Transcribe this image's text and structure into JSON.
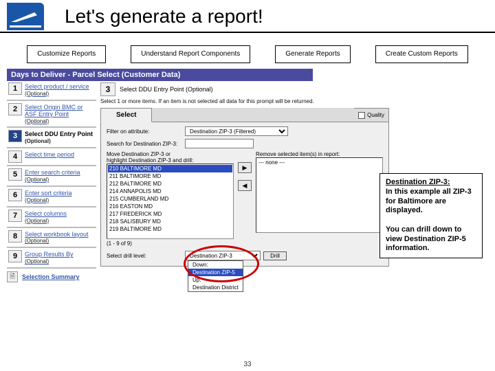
{
  "header": {
    "title": "Let's generate a report!"
  },
  "nav": [
    {
      "label": "Customize Reports"
    },
    {
      "label": "Understand Report Components"
    },
    {
      "label": "Generate Reports"
    },
    {
      "label": "Create Custom Reports"
    }
  ],
  "breadcrumb": "Days to Deliver - Parcel Select (Customer Data)",
  "steps": [
    {
      "n": "1",
      "label": "Select product / service",
      "sub": "(Optional)"
    },
    {
      "n": "2",
      "label": "Select Origin BMC or ASF Entry Point",
      "sub": "(Optional)"
    },
    {
      "n": "3",
      "label": "Select DDU Entry Point",
      "sub": "(Optional)",
      "current": true
    },
    {
      "n": "4",
      "label": "Select time period",
      "sub": ""
    },
    {
      "n": "5",
      "label": "Enter search criteria",
      "sub": "(Optional)"
    },
    {
      "n": "6",
      "label": "Enter sort criteria",
      "sub": "(Optional)"
    },
    {
      "n": "7",
      "label": "Select columns",
      "sub": "(Optional)"
    },
    {
      "n": "8",
      "label": "Select workbook layout",
      "sub": "(Optional)"
    },
    {
      "n": "9",
      "label": "Group Results By",
      "sub": "(Optional)"
    }
  ],
  "summary": {
    "label": "Selection Summary"
  },
  "main": {
    "stepnum": "3",
    "heading": "Select DDU Entry Point (Optional)",
    "instr": "Select 1 or more items. If an item is not selected all data for this prompt will be returned."
  },
  "tabs": {
    "select": "Select",
    "quality": "Quality"
  },
  "filter": {
    "lbl_on": "Filter on attribute:",
    "attr": "Destination ZIP-3 (Filtered)",
    "lbl_search": "Search for Destination ZIP-3:",
    "search": ""
  },
  "left": {
    "caption1": "Move Destination ZIP-3 or",
    "caption2": "highlight Destination ZIP-3 and drill:",
    "items": [
      "210 BALTIMORE MD",
      "211 BALTIMORE MD",
      "212 BALTIMORE MD",
      "214 ANNAPOLIS MD",
      "215 CUMBERLAND MD",
      "216 EASTON MD",
      "217 FREDERICK MD",
      "218 SALISBURY MD",
      "219 BALTIMORE MD"
    ],
    "pager": "(1 - 9 of 9)"
  },
  "right": {
    "caption": "Remove selected item(s) in report:",
    "none": "--- none ---"
  },
  "drill": {
    "lbl": "Select drill level:",
    "cur": "Destination ZIP-3",
    "btn": "Drill",
    "menu": [
      "Down:",
      "Destination ZIP-5",
      "Up:",
      "Destination District"
    ]
  },
  "callout": {
    "h": "Destination ZIP-3:",
    "p1a": "In this example all ZIP-3 for Baltimore are displayed.",
    "p2": "You can drill down to view Destination ZIP-5 information."
  },
  "pagenum": "33"
}
